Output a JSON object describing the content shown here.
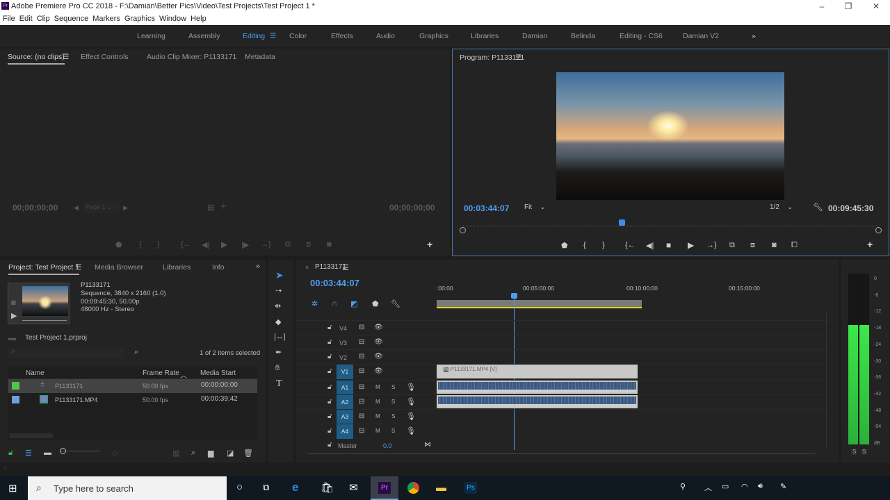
{
  "window": {
    "title": "Adobe Premiere Pro CC 2018 - F:\\Damian\\Better Pics\\Video\\Test Projects\\Test Project 1 *",
    "app_icon": "Pr"
  },
  "menu": [
    "File",
    "Edit",
    "Clip",
    "Sequence",
    "Markers",
    "Graphics",
    "Window",
    "Help"
  ],
  "workspaces": [
    "Learning",
    "Assembly",
    "Editing",
    "Color",
    "Effects",
    "Audio",
    "Graphics",
    "Libraries",
    "Damian",
    "Belinda",
    "Editing - CS6",
    "Damian V2"
  ],
  "source_panel": {
    "tabs": [
      "Source: (no clips)",
      "Effect Controls",
      "Audio Clip Mixer: P1133171",
      "Metadata"
    ],
    "timecode_in": "00;00;00;00",
    "timecode_out": "00;00;00;00",
    "page": "Page 1"
  },
  "program_panel": {
    "title": "Program: P1133171",
    "timecode": "00:03:44:07",
    "zoom": "Fit",
    "resolution": "1/2",
    "duration": "00:09:45:30",
    "playhead_fraction": 0.383
  },
  "project_panel": {
    "tabs": [
      "Project: Test Project 1",
      "Media Browser",
      "Libraries",
      "Info"
    ],
    "preview": {
      "name": "P1133171",
      "line1": "Sequence, 3840 x 2160 (1.0)",
      "line2": "00:09:45:30, 50.00p",
      "line3": "48000 Hz - Stereo"
    },
    "project_file": "Test Project 1.prproj",
    "selection": "1 of 2 items selected",
    "columns": [
      "Name",
      "Frame Rate",
      "Media Start"
    ],
    "items": [
      {
        "name": "P1133171",
        "frame_rate": "50.00 fps",
        "media_start": "00:00:00:00",
        "label_color": "#4fc44f"
      },
      {
        "name": "P1133171.MP4",
        "frame_rate": "50.00 fps",
        "media_start": "00:00:39:42",
        "label_color": "#6e9fde"
      }
    ]
  },
  "timeline": {
    "tab": "P1133171",
    "timecode": "00:03:44:07",
    "ruler": [
      ":00:00",
      "00:05:00:00",
      "00:10:00:00",
      "00:15:00:00"
    ],
    "video_tracks": [
      "V4",
      "V3",
      "V2",
      "V1"
    ],
    "audio_tracks": [
      "A1",
      "A2",
      "A3",
      "A4"
    ],
    "mute": "M",
    "solo": "S",
    "master_label": "Master",
    "master_value": "0.0",
    "video_clip": "P1133171.MP4 [V]",
    "playhead_minutes": 3.735,
    "clip_end_minutes": 9.76
  },
  "audio_meter": {
    "scale": [
      "0",
      "-6",
      "-12",
      "-18",
      "-24",
      "-30",
      "-36",
      "-42",
      "-48",
      "-54",
      "dB"
    ],
    "solo_buttons": [
      "S",
      "S"
    ],
    "level_db": -18
  },
  "taskbar": {
    "search_placeholder": "Type here to search"
  }
}
